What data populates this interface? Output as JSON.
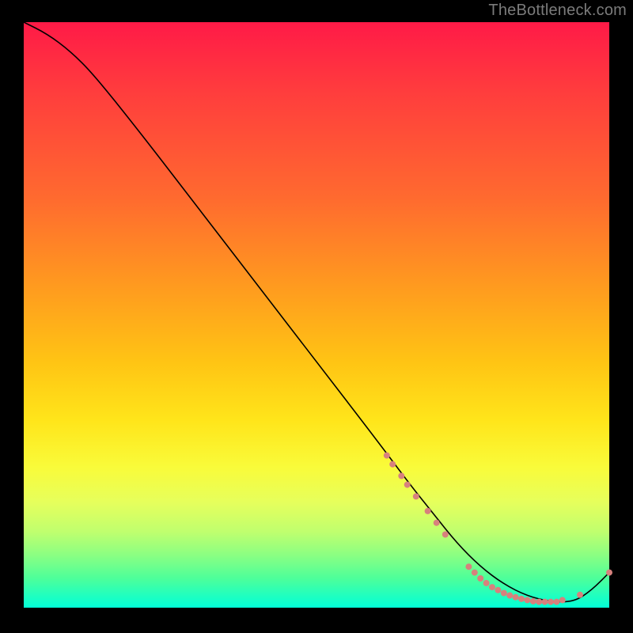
{
  "attribution": "TheBottleneck.com",
  "chart_data": {
    "type": "line",
    "title": "",
    "xlabel": "",
    "ylabel": "",
    "xlim": [
      0,
      100
    ],
    "ylim": [
      0,
      100
    ],
    "grid": false,
    "legend": false,
    "background_gradient": {
      "orientation": "vertical",
      "stops": [
        {
          "pos": 0.0,
          "color": "#ff1a47"
        },
        {
          "pos": 0.3,
          "color": "#ff6a2f"
        },
        {
          "pos": 0.6,
          "color": "#ffc414"
        },
        {
          "pos": 0.78,
          "color": "#f3fb3f"
        },
        {
          "pos": 0.9,
          "color": "#8bff82"
        },
        {
          "pos": 1.0,
          "color": "#02ffd7"
        }
      ]
    },
    "series": [
      {
        "name": "bottleneck-curve",
        "type": "line",
        "color": "#000000",
        "x": [
          0,
          4,
          8,
          12,
          20,
          30,
          40,
          50,
          60,
          66,
          70,
          74,
          78,
          82,
          86,
          90,
          94,
          97,
          100
        ],
        "y": [
          100,
          98,
          95,
          91,
          81,
          68,
          55,
          42,
          29,
          21,
          16,
          11,
          7,
          4,
          2,
          1,
          1,
          3,
          6
        ]
      }
    ],
    "markers": {
      "name": "highlight-points",
      "color": "#d7817d",
      "radius": 4,
      "points": [
        {
          "x": 62,
          "y": 26.0
        },
        {
          "x": 63,
          "y": 24.5
        },
        {
          "x": 64.5,
          "y": 22.5
        },
        {
          "x": 65.5,
          "y": 21.0
        },
        {
          "x": 67,
          "y": 19.0
        },
        {
          "x": 69,
          "y": 16.5
        },
        {
          "x": 70.5,
          "y": 14.5
        },
        {
          "x": 72,
          "y": 12.5
        },
        {
          "x": 76,
          "y": 7.0
        },
        {
          "x": 77,
          "y": 6.0
        },
        {
          "x": 78,
          "y": 5.0
        },
        {
          "x": 79,
          "y": 4.2
        },
        {
          "x": 80,
          "y": 3.5
        },
        {
          "x": 81,
          "y": 3.0
        },
        {
          "x": 82,
          "y": 2.5
        },
        {
          "x": 83,
          "y": 2.1
        },
        {
          "x": 84,
          "y": 1.8
        },
        {
          "x": 85,
          "y": 1.5
        },
        {
          "x": 86,
          "y": 1.3
        },
        {
          "x": 87,
          "y": 1.1
        },
        {
          "x": 88,
          "y": 1.0
        },
        {
          "x": 89,
          "y": 1.0
        },
        {
          "x": 90,
          "y": 1.0
        },
        {
          "x": 91,
          "y": 1.0
        },
        {
          "x": 92,
          "y": 1.3
        },
        {
          "x": 95,
          "y": 2.2
        },
        {
          "x": 100,
          "y": 6.0
        }
      ]
    }
  }
}
